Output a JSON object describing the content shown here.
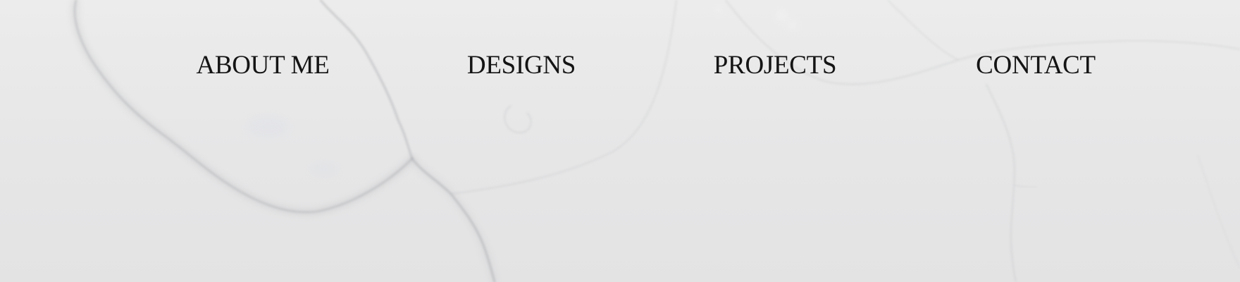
{
  "background": {
    "texture": "white-marble",
    "base_color": "#e8e8e9",
    "vein_color": "#a9aaae"
  },
  "nav": {
    "items": [
      {
        "label": "ABOUT ME"
      },
      {
        "label": "DESIGNS"
      },
      {
        "label": "PROJECTS"
      },
      {
        "label": "CONTACT"
      }
    ],
    "text_color": "#141414"
  }
}
